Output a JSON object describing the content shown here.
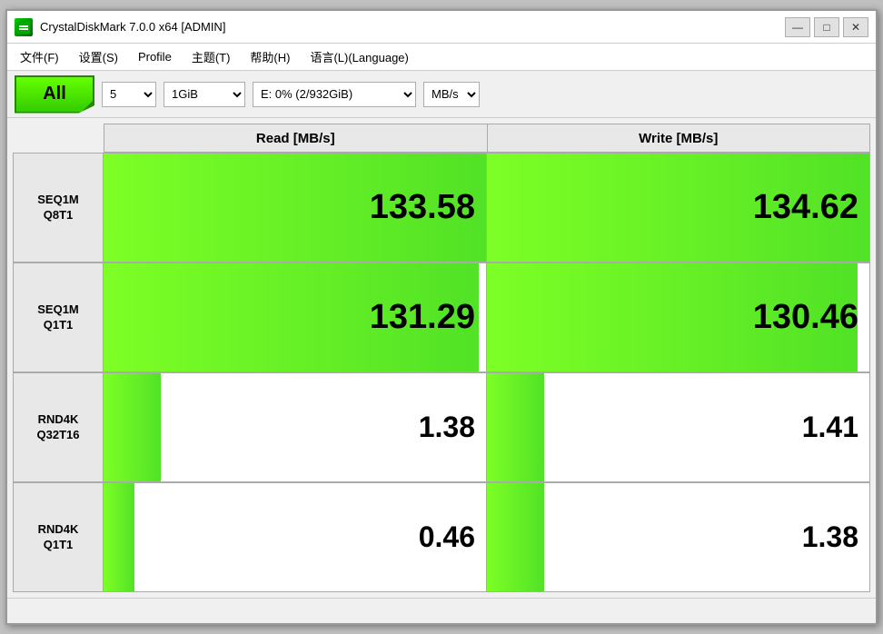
{
  "window": {
    "title": "CrystalDiskMark 7.0.0 x64 [ADMIN]",
    "app_icon_text": "■"
  },
  "titlebar": {
    "minimize_label": "—",
    "maximize_label": "□",
    "close_label": "✕"
  },
  "menubar": {
    "items": [
      {
        "id": "file",
        "label": "文件(F)"
      },
      {
        "id": "settings",
        "label": "设置(S)"
      },
      {
        "id": "profile",
        "label": "Profile"
      },
      {
        "id": "theme",
        "label": "主题(T)"
      },
      {
        "id": "help",
        "label": "帮助(H)"
      },
      {
        "id": "language",
        "label": "语言(L)(Language)"
      }
    ]
  },
  "toolbar": {
    "all_button_label": "All",
    "count_value": "5",
    "size_value": "1GiB",
    "drive_value": "E: 0% (2/932GiB)",
    "unit_value": "MB/s"
  },
  "table": {
    "headers": [
      "Read [MB/s]",
      "Write [MB/s]"
    ],
    "rows": [
      {
        "label_line1": "SEQ1M",
        "label_line2": "Q8T1",
        "read_value": "133.58",
        "write_value": "134.62",
        "read_bar_pct": 100,
        "write_bar_pct": 100
      },
      {
        "label_line1": "SEQ1M",
        "label_line2": "Q1T1",
        "read_value": "131.29",
        "write_value": "130.46",
        "read_bar_pct": 98,
        "write_bar_pct": 97
      },
      {
        "label_line1": "RND4K",
        "label_line2": "Q32T16",
        "read_value": "1.38",
        "write_value": "1.41",
        "read_bar_pct": 15,
        "write_bar_pct": 15
      },
      {
        "label_line1": "RND4K",
        "label_line2": "Q1T1",
        "read_value": "0.46",
        "write_value": "1.38",
        "read_bar_pct": 8,
        "write_bar_pct": 15
      }
    ]
  },
  "statusbar": {
    "text": ""
  }
}
